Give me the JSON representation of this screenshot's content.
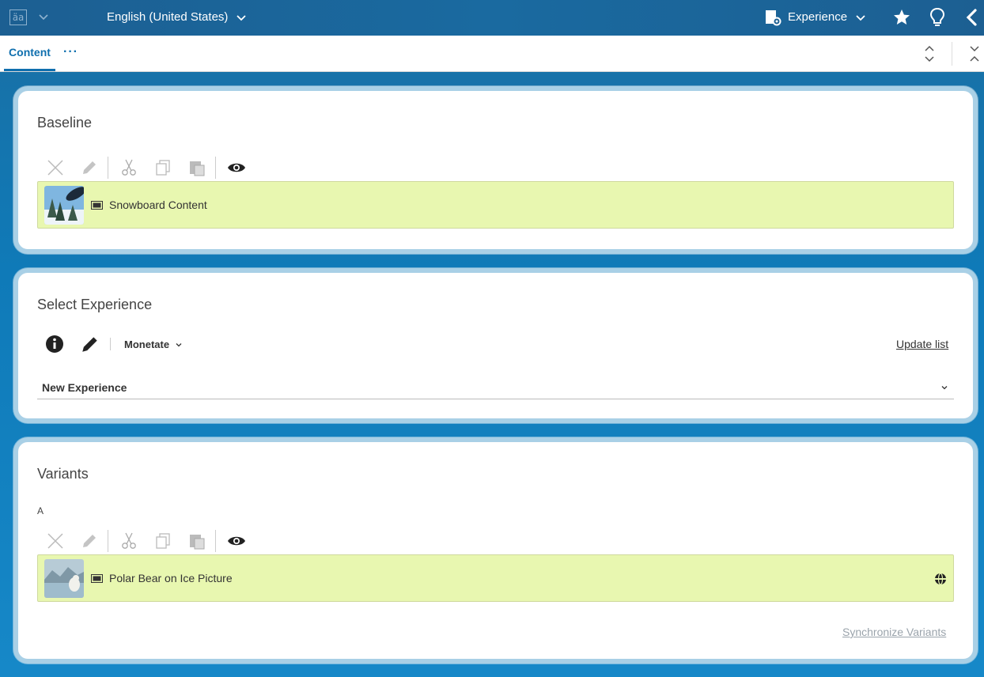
{
  "topbar": {
    "language_icon_glyph": "äa",
    "language_label": "English (United States)",
    "experience_label": "Experience",
    "icons": [
      "language-icon",
      "chevron-down-icon",
      "experience-settings-icon",
      "star-icon",
      "lightbulb-icon",
      "back-arrow-icon"
    ]
  },
  "tabs": {
    "content_label": "Content",
    "more_label": "···"
  },
  "baseline": {
    "title": "Baseline",
    "item_label": "Snowboard Content"
  },
  "experience": {
    "title": "Select Experience",
    "provider_label": "Monetate",
    "update_link": "Update list",
    "selected_value": "New Experience"
  },
  "variants": {
    "title": "Variants",
    "variant_letter": "A",
    "item_label": "Polar Bear on Ice Picture",
    "sync_link": "Synchronize Variants"
  },
  "colors": {
    "topbar": "#1c5f92",
    "accent": "#0f6fae",
    "item_bg": "#e8f7b0",
    "panel_border": "#a9d0e6"
  }
}
